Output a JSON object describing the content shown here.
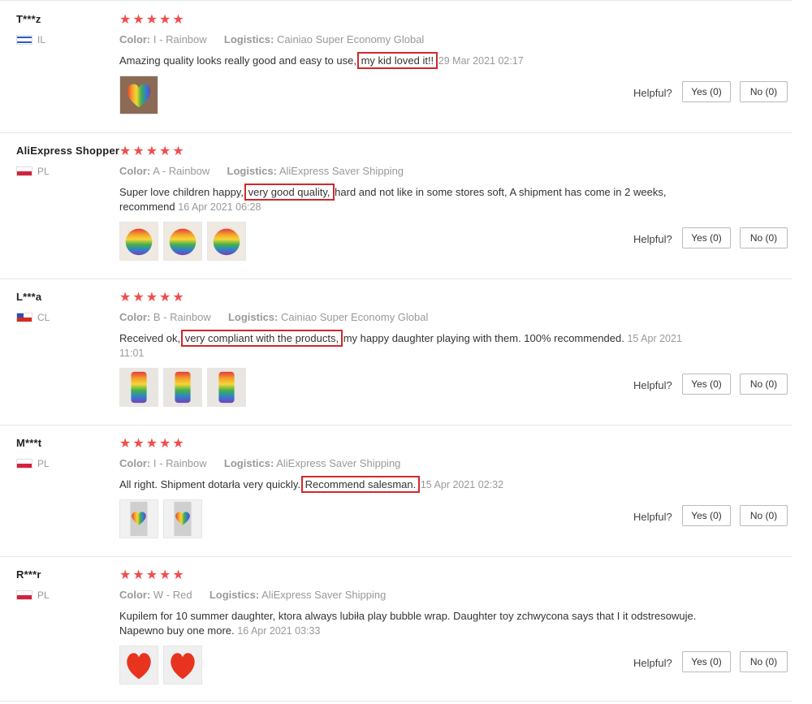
{
  "labels": {
    "color_key": "Color:",
    "logistics_key": "Logistics:",
    "helpful": "Helpful?",
    "stars": "★★★★★"
  },
  "reviews": [
    {
      "user": "T***z",
      "country": "IL",
      "flag": "il",
      "color": "I - Rainbow",
      "logistics": "Cainiao Super Economy Global",
      "text_before": "Amazing quality looks really good and easy to use,",
      "highlight": "my kid loved it!!",
      "text_after": "",
      "date": "29 Mar 2021 02:17",
      "yes": "Yes (0)",
      "no": "No (0)",
      "photos": [
        "heart"
      ]
    },
    {
      "user": "AliExpress Shopper",
      "country": "PL",
      "flag": "pl",
      "color": "A - Rainbow",
      "logistics": "AliExpress Saver Shipping",
      "text_before": "Super love children happy,",
      "highlight": "very good quality,",
      "text_after": "hard and not like in some stores soft, A shipment has come in 2 weeks, recommend",
      "date": "16 Apr 2021 06:28",
      "yes": "Yes (0)",
      "no": "No (0)",
      "photos": [
        "circle",
        "circle",
        "circle"
      ]
    },
    {
      "user": "L***a",
      "country": "CL",
      "flag": "cl",
      "color": "B - Rainbow",
      "logistics": "Cainiao Super Economy Global",
      "text_before": "Received ok,",
      "highlight": "very compliant with the products,",
      "text_after": "my happy daughter playing with them. 100% recommended.",
      "date": "15 Apr 2021 11:01",
      "yes": "Yes (0)",
      "no": "No (0)",
      "photos": [
        "rect",
        "rect",
        "rect"
      ]
    },
    {
      "user": "M***t",
      "country": "PL",
      "flag": "pl",
      "color": "I - Rainbow",
      "logistics": "AliExpress Saver Shipping",
      "text_before": "All right. Shipment dotarła very quickly.",
      "highlight": "Recommend salesman.",
      "text_after": "",
      "date": "15 Apr 2021 02:32",
      "yes": "Yes (0)",
      "no": "No (0)",
      "photos": [
        "heart-pack",
        "heart-pack"
      ]
    },
    {
      "user": "R***r",
      "country": "PL",
      "flag": "pl",
      "color": "W - Red",
      "logistics": "AliExpress Saver Shipping",
      "text_before": "Kupilem for 10 summer daughter, ktora always lubiła play bubble wrap. Daughter toy zchwycona says that I it odstresowuje. Napewno buy one more.",
      "highlight": "",
      "text_after": "",
      "date": "16 Apr 2021 03:33",
      "yes": "Yes (0)",
      "no": "No (0)",
      "photos": [
        "red",
        "red"
      ]
    }
  ],
  "colors": {
    "star": "#f04e4e",
    "highlight_box": "#d0282c"
  }
}
